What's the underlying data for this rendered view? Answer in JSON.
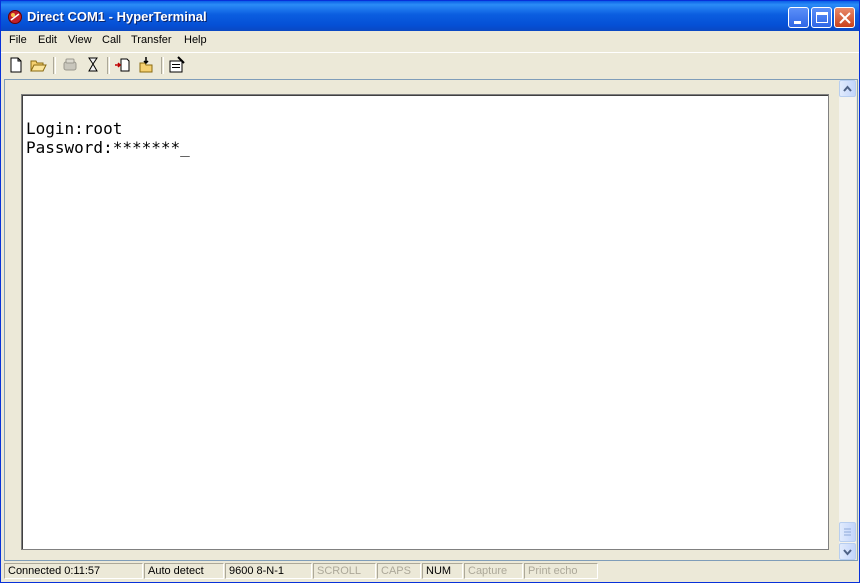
{
  "window": {
    "title": "Direct COM1 - HyperTerminal",
    "icon": "hyperterminal-icon",
    "controls": [
      "minimize-icon",
      "maximize-icon",
      "close-icon"
    ]
  },
  "menu": [
    "File",
    "Edit",
    "View",
    "Call",
    "Transfer",
    "Help"
  ],
  "toolbar": [
    "new-icon",
    "open-icon",
    "disconnect-icon",
    "dial-icon",
    "send-file-icon",
    "receive-file-icon",
    "properties-icon"
  ],
  "terminal": {
    "lines": [
      "Login:root",
      "Password:*******_"
    ]
  },
  "status": [
    {
      "text": "Connected 0:11:57",
      "enabled": true
    },
    {
      "text": "Auto detect",
      "enabled": true
    },
    {
      "text": "9600 8-N-1",
      "enabled": true
    },
    {
      "text": "SCROLL",
      "enabled": false
    },
    {
      "text": "CAPS",
      "enabled": false
    },
    {
      "text": "NUM",
      "enabled": true
    },
    {
      "text": "Capture",
      "enabled": false
    },
    {
      "text": "Print echo",
      "enabled": false
    }
  ],
  "colors": {
    "titlebar": "#0a5fe8",
    "chrome": "#ece9d8",
    "terminal_bg": "#ffffff"
  }
}
